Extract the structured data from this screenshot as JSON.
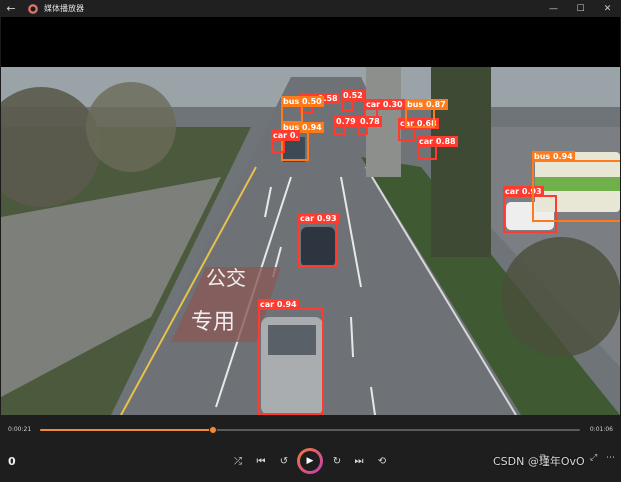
{
  "window": {
    "title": "媒体播放器",
    "back_icon": "arrow-left-icon",
    "controls": [
      "minimize",
      "maximize",
      "close"
    ]
  },
  "detections": [
    {
      "label": "car 0.94",
      "class": "car"
    },
    {
      "label": "car 0.93",
      "class": "car"
    },
    {
      "label": "car 0.93",
      "class": "car"
    },
    {
      "label": "bus 0.94",
      "class": "bus"
    },
    {
      "label": "car 0.88",
      "class": "car"
    },
    {
      "label": "car 0.68",
      "class": "car"
    },
    {
      "label": "bus 0.87",
      "class": "bus"
    },
    {
      "label": "car 0.30",
      "class": "car"
    },
    {
      "label": "car 0.58",
      "class": "car"
    },
    {
      "label": "0.52",
      "class": "car"
    },
    {
      "label": "bus 0.94",
      "class": "bus"
    },
    {
      "label": "0.79",
      "class": "car"
    },
    {
      "label": "0.78",
      "class": "car"
    },
    {
      "label": "car 0.",
      "class": "car"
    },
    {
      "label": "bus 0.50",
      "class": "bus"
    }
  ],
  "road_text": "公交 专用",
  "player": {
    "current_time": "0:00:21",
    "total_time": "0:01:06",
    "progress": 0.32,
    "volume_value": "0",
    "accent": "#f08a3c"
  },
  "watermark": "CSDN @瑾年OvO"
}
